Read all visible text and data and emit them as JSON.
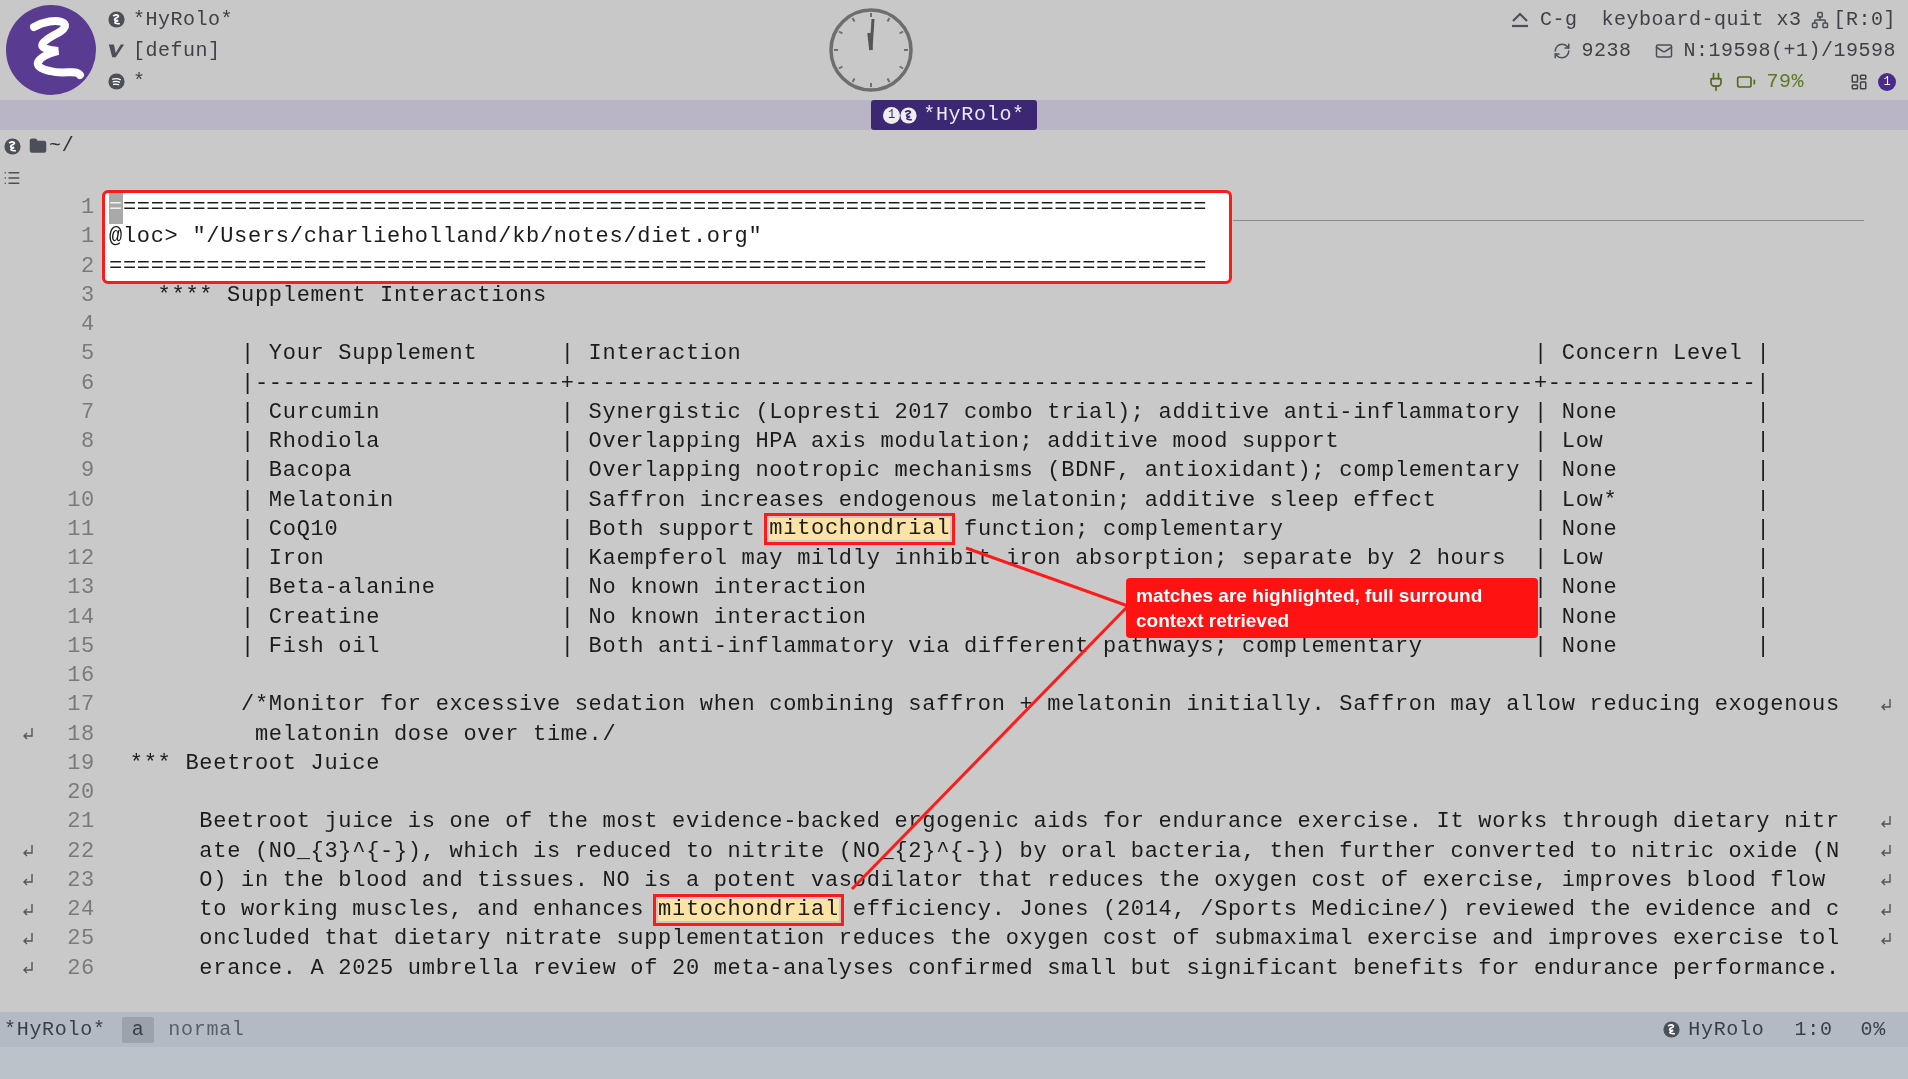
{
  "header": {
    "lines": [
      {
        "kind": "buffer",
        "text": "*HyRolo*"
      },
      {
        "kind": "function",
        "text": "[defun]"
      },
      {
        "kind": "player",
        "text": "*"
      }
    ],
    "key": "C-g",
    "command": "keyboard-quit x3",
    "repo": "[R:0]",
    "sync": "9238",
    "mail": "N:19598(+1)/19598",
    "battery": "79%",
    "workspace_badge": "1"
  },
  "tab": {
    "number": "1",
    "label": "*HyRolo*",
    "selected": true
  },
  "path": "~/",
  "editor": {
    "lines": [
      {
        "number": "1",
        "continued": false,
        "continues": false,
        "segments": [
          {
            "kind": "cursor",
            "text": "="
          },
          {
            "kind": "plain",
            "text": "=============================================================================="
          }
        ]
      },
      {
        "number": "1",
        "continued": false,
        "continues": false,
        "text": "@loc> \"/Users/charlieholland/kb/notes/diet.org\""
      },
      {
        "number": "2",
        "continued": false,
        "continues": false,
        "text": "==============================================================================="
      },
      {
        "number": "3",
        "continued": false,
        "continues": false,
        "text": "    **** Supplement Interactions"
      },
      {
        "number": "4",
        "continued": false,
        "continues": false
      },
      {
        "number": "5",
        "continued": false,
        "continues": false,
        "text": "          | Your Supplement      | Interaction                                                         | Concern Level |"
      },
      {
        "number": "6",
        "continued": false,
        "continues": false,
        "text": "          |----------------------+---------------------------------------------------------------------+---------------|"
      },
      {
        "number": "7",
        "continued": false,
        "continues": false,
        "text": "          | Curcumin             | Synergistic (Lopresti 2017 combo trial); additive anti-inflammatory | None          |"
      },
      {
        "number": "8",
        "continued": false,
        "continues": false,
        "text": "          | Rhodiola             | Overlapping HPA axis modulation; additive mood support              | Low           |"
      },
      {
        "number": "9",
        "continued": false,
        "continues": false,
        "text": "          | Bacopa               | Overlapping nootropic mechanisms (BDNF, antioxidant); complementary | None          |"
      },
      {
        "number": "10",
        "continued": false,
        "continues": false,
        "text": "          | Melatonin            | Saffron increases endogenous melatonin; additive sleep effect       | Low*          |"
      },
      {
        "number": "11",
        "continued": false,
        "continues": false,
        "segments": [
          {
            "kind": "plain",
            "text": "          | CoQ10                | Both support "
          },
          {
            "kind": "match",
            "text": "mitochondrial"
          },
          {
            "kind": "plain",
            "text": " function; complementary                  | None          |"
          }
        ]
      },
      {
        "number": "12",
        "continued": false,
        "continues": false,
        "text": "          | Iron                 | Kaempferol may mildly inhibit iron absorption; separate by 2 hours  | Low           |"
      },
      {
        "number": "13",
        "continued": false,
        "continues": false,
        "text": "          | Beta-alanine         | No known interaction                                                | None          |"
      },
      {
        "number": "14",
        "continued": false,
        "continues": false,
        "text": "          | Creatine             | No known interaction                                                | None          |"
      },
      {
        "number": "15",
        "continued": false,
        "continues": false,
        "text": "          | Fish oil             | Both anti-inflammatory via different pathways; complementary        | None          |"
      },
      {
        "number": "16",
        "continued": false,
        "continues": false
      },
      {
        "number": "17",
        "continued": false,
        "continues": true,
        "text": "          /*Monitor for excessive sedation when combining saffron + melatonin initially. Saffron may allow reducing exogenous"
      },
      {
        "number": "18",
        "continued": true,
        "continues": false,
        "text": "           melatonin dose over time./"
      },
      {
        "number": "19",
        "continued": false,
        "continues": false,
        "text": "  *** Beetroot Juice"
      },
      {
        "number": "20",
        "continued": false,
        "continues": false
      },
      {
        "number": "21",
        "continued": false,
        "continues": true,
        "text": "       Beetroot juice is one of the most evidence-backed ergogenic aids for endurance exercise. It works through dietary nitr"
      },
      {
        "number": "22",
        "continued": true,
        "continues": true,
        "text": "       ate (NO_{3}^{-}), which is reduced to nitrite (NO_{2}^{-}) by oral bacteria, then further converted to nitric oxide (N"
      },
      {
        "number": "23",
        "continued": true,
        "continues": true,
        "text": "       O) in the blood and tissues. NO is a potent vasodilator that reduces the oxygen cost of exercise, improves blood flow"
      },
      {
        "number": "24",
        "continued": true,
        "continues": true,
        "segments": [
          {
            "kind": "plain",
            "text": "       to working muscles, and enhances "
          },
          {
            "kind": "match",
            "text": "mitochondrial"
          },
          {
            "kind": "plain",
            "text": " efficiency. Jones (2014, /Sports Medicine/) reviewed the evidence and c"
          }
        ]
      },
      {
        "number": "25",
        "continued": true,
        "continues": true,
        "text": "       oncluded that dietary nitrate supplementation reduces the oxygen cost of submaximal exercise and improves exercise tol"
      },
      {
        "number": "26",
        "continued": true,
        "continues": false,
        "text": "       erance. A 2025 umbrella review of 20 meta-analyses confirmed small but significant benefits for endurance performance."
      }
    ]
  },
  "callout": {
    "text": "matches are highlighted, full surround context retrieved"
  },
  "mode_line": {
    "buffer": "*HyRolo*",
    "state_key": "a",
    "state": "normal",
    "major_mode": "HyRolo",
    "position": "1:0",
    "percent": "0%"
  }
}
